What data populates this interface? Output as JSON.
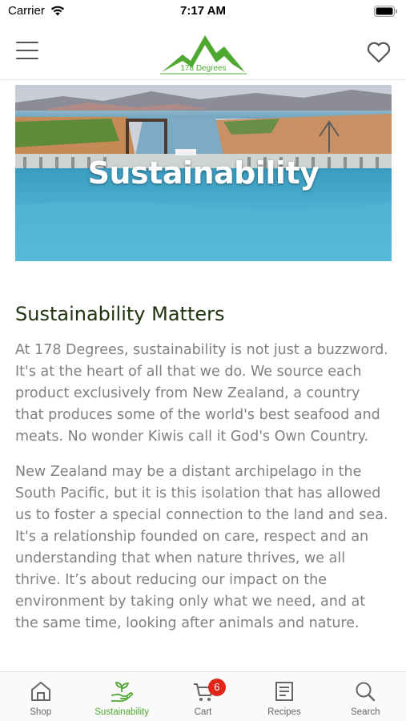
{
  "status_bar": {
    "carrier": "Carrier",
    "time": "7:17 AM"
  },
  "header": {
    "logo_text": "178 Degrees",
    "icons": {
      "menu": "hamburger-menu-icon",
      "favorite": "heart-icon"
    }
  },
  "hero": {
    "title": "Sustainability"
  },
  "main": {
    "heading": "Sustainability Matters",
    "paragraphs": [
      "At 178 Degrees, sustainability is not just a buzzword. It's at the heart of all that we do. We source each product exclusively from New Zealand, a country that produces some of the world's best seafood and meats. No wonder Kiwis call it God's Own Country.",
      "New Zealand may be a distant archipelago in the South Pacific, but it is this isolation that has allowed us to foster a special connection to the land and sea. It's a relationship founded on care, respect and an understanding that when nature thrives, we all thrive. It’s about reducing our impact on the environment by taking only what we need, and at the same time, looking after animals and nature."
    ]
  },
  "tab_bar": {
    "tabs": [
      {
        "label": "Shop",
        "icon": "home-icon"
      },
      {
        "label": "Sustainability",
        "icon": "sprout-hand-icon",
        "active": true
      },
      {
        "label": "Cart",
        "icon": "cart-icon",
        "badge": "6"
      },
      {
        "label": "Recipes",
        "icon": "recipe-book-icon"
      },
      {
        "label": "Search",
        "icon": "search-icon"
      }
    ]
  },
  "colors": {
    "brand_green": "#4fa830",
    "heading_green": "#20320f",
    "body_text": "#808080",
    "badge_red": "#e0251b"
  }
}
